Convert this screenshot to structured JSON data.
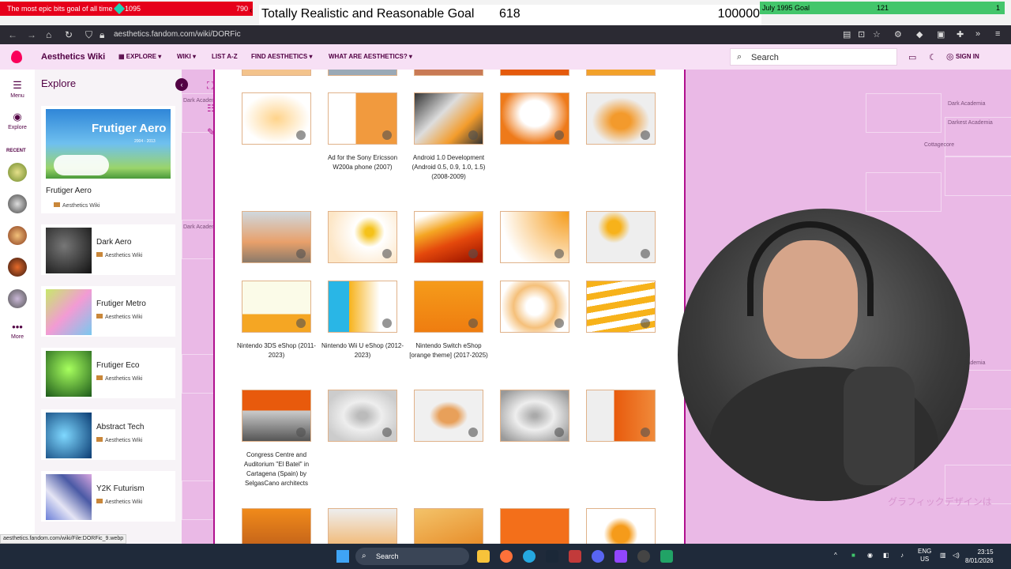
{
  "goals": {
    "left": {
      "title": "The most epic bits goal of all time",
      "current": "1095",
      "target": "790"
    },
    "center": {
      "title": "Totally Realistic and Reasonable Goal",
      "current": "618",
      "target": "100000"
    },
    "right": {
      "title": "July 1995 Goal",
      "current": "121",
      "target": "1"
    }
  },
  "browser": {
    "url": "aesthetics.fandom.com/wiki/DORFic"
  },
  "header": {
    "wiki_name": "Aesthetics Wiki",
    "nav": [
      "EXPLORE",
      "WIKI",
      "LIST A-Z",
      "FIND AESTHETICS",
      "WHAT ARE AESTHETICS?"
    ],
    "search_placeholder": "Search",
    "sign_in": "SIGN IN"
  },
  "rail": {
    "menu": "Menu",
    "explore": "Explore",
    "recent": "RECENT",
    "more": "More"
  },
  "explore": {
    "title": "Explore",
    "featured": {
      "name": "Frutiger Aero",
      "source": "Aesthetics Wiki",
      "img_title": "Frutiger Aero",
      "img_years": "2004 - 2013"
    },
    "items": [
      {
        "name": "Dark Aero",
        "source": "Aesthetics Wiki"
      },
      {
        "name": "Frutiger Metro",
        "source": "Aesthetics Wiki"
      },
      {
        "name": "Frutiger Eco",
        "source": "Aesthetics Wiki"
      },
      {
        "name": "Abstract Tech",
        "source": "Aesthetics Wiki"
      },
      {
        "name": "Y2K Futurism",
        "source": "Aesthetics Wiki"
      }
    ]
  },
  "gallery": {
    "captions": [
      "Ad for the Sony Ericsson W200a phone (2007)",
      "Android 1.0 Development (Android 0.5, 0.9, 1.0, 1.5) (2008-2009)",
      "Nintendo 3DS eShop (2011-2023)",
      "Nintendo Wii U eShop (2012-2023)",
      "Nintendo Switch eShop [orange theme] (2017-2025)",
      "Congress Centre and Auditorium \"El Batel\" in Cartagena (Spain) by SelgasCano architects"
    ]
  },
  "background": {
    "labels": [
      "Dark Academia",
      "Darkest Academia",
      "Cottagecore",
      "Dark Academia",
      "Dark Academia",
      "Dark Academia"
    ],
    "jp_text": "グラフィックデザインは"
  },
  "status_url": "aesthetics.fandom.com/wiki/File:DORFic_9.webp",
  "taskbar": {
    "search": "Search",
    "lang_top": "ENG",
    "lang_bottom": "US",
    "time": "23:15",
    "date": "8/01/2026"
  }
}
